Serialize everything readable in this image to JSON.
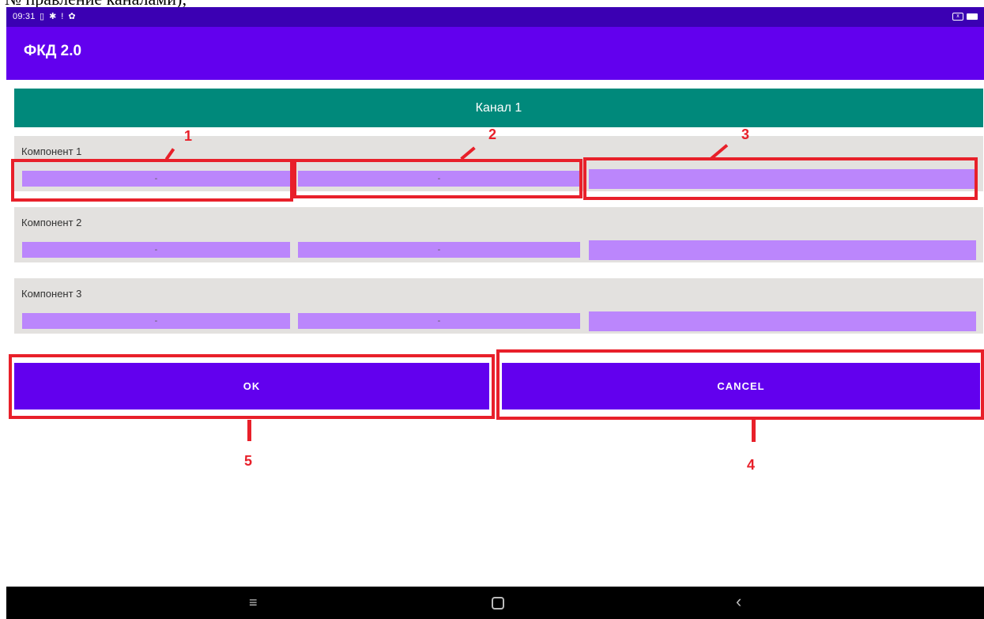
{
  "doc_text": "№ правление каналами);",
  "status_bar": {
    "time": "09:31",
    "icons": [
      "vibrate-icon",
      "bluetooth-icon",
      "alert-icon",
      "gear-icon"
    ]
  },
  "app": {
    "title": "ФКД 2.0"
  },
  "channel": {
    "title": "Канал 1"
  },
  "components": [
    {
      "label": "Компонент 1",
      "field1": "-",
      "field2": "-",
      "field3": ""
    },
    {
      "label": "Компонент 2",
      "field1": "-",
      "field2": "-",
      "field3": ""
    },
    {
      "label": "Компонент 3",
      "field1": "-",
      "field2": "-",
      "field3": ""
    }
  ],
  "buttons": {
    "ok": "OK",
    "cancel": "CANCEL"
  },
  "annotations": [
    "1",
    "2",
    "3",
    "4",
    "5"
  ],
  "nav": {
    "menu": "≡",
    "back": "‹"
  },
  "colors": {
    "status_bar": "#3b00b3",
    "app_bar": "#6200ee",
    "channel_header": "#00897b",
    "field": "#bb86fc",
    "annotation": "#e8202a"
  }
}
